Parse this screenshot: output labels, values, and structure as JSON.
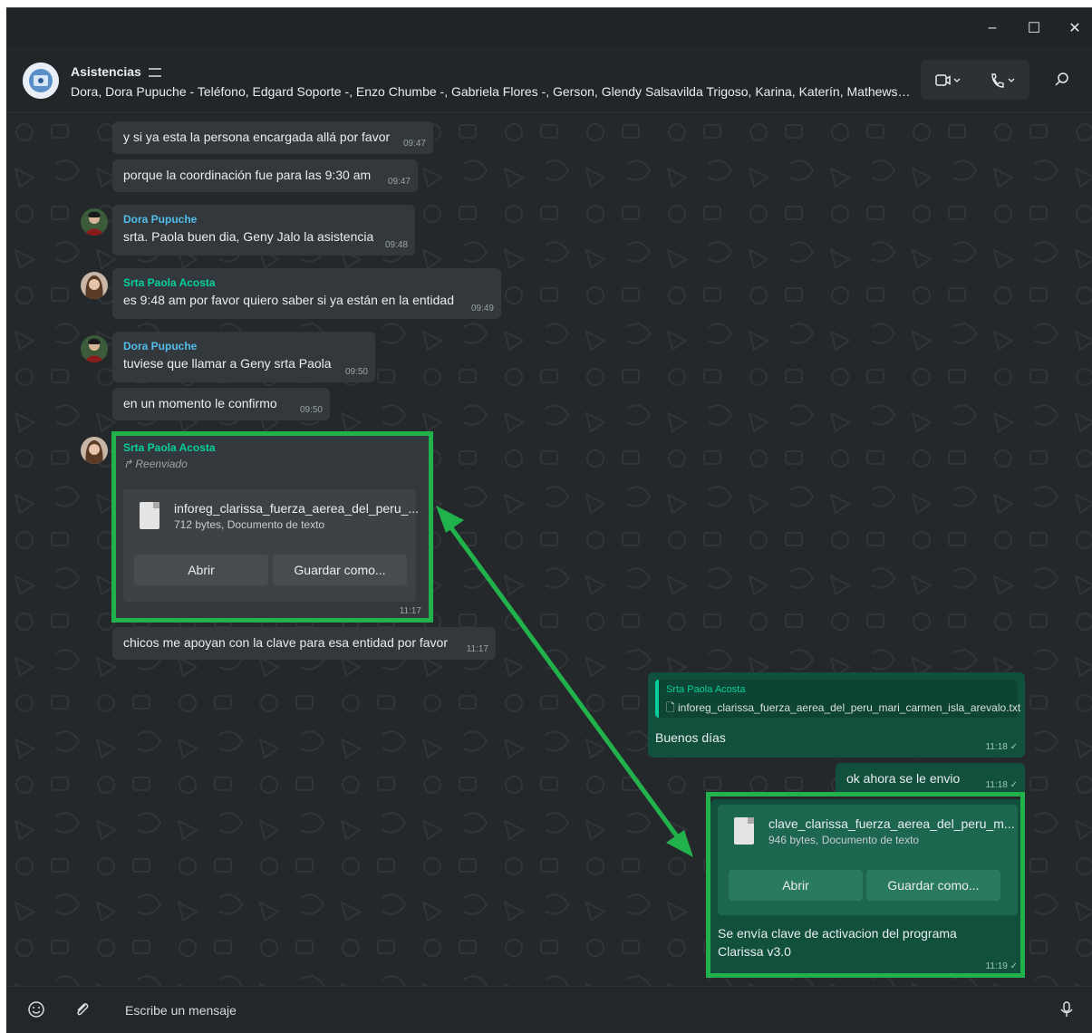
{
  "window": {
    "minimize": "–",
    "maximize": "☐",
    "close": "✕"
  },
  "header": {
    "title": "Asistencias",
    "participants": "Dora, Dora Pupuche - Teléfono, Edgard Soporte -, Enzo Chumbe -, Gabriela Flores -, Gerson, Glendy Salsavilda Trigoso, Karina, Katerín, Mathews Gue..."
  },
  "messages": {
    "m1": {
      "text": "y si ya esta la persona encargada allá por favor",
      "time": "09:47"
    },
    "m2": {
      "text": "porque la coordinación fue para las 9:30 am",
      "time": "09:47"
    },
    "m3": {
      "sender": "Dora Pupuche",
      "text": "srta. Paola buen dia, Geny Jalo la asistencia",
      "time": "09:48"
    },
    "m4": {
      "sender": "Srta Paola Acosta",
      "text": "es 9:48 am por favor quiero saber si ya están en la entidad",
      "time": "09:49"
    },
    "m5": {
      "sender": "Dora Pupuche",
      "text": "tuviese que llamar a Geny srta Paola",
      "time": "09:50"
    },
    "m6": {
      "text": "en un momento le confirmo",
      "time": "09:50"
    },
    "m7": {
      "sender": "Srta Paola Acosta",
      "forwarded": "Reenviado",
      "file_name": "inforeg_clarissa_fuerza_aerea_del_peru_...",
      "file_meta": "712 bytes, Documento de texto",
      "open": "Abrir",
      "save": "Guardar como...",
      "time": "11:17"
    },
    "m8": {
      "text": "chicos me apoyan con la clave para esa entidad por favor",
      "time": "11:17"
    },
    "m9": {
      "quote_sender": "Srta Paola Acosta",
      "quote_file": "inforeg_clarissa_fuerza_aerea_del_peru_mari_carmen_isla_arevalo.txt",
      "text": "Buenos días",
      "time": "11:18 ✓"
    },
    "m10": {
      "text": "ok ahora se le envio",
      "time": "11:18 ✓"
    },
    "m11": {
      "file_name": "clave_clarissa_fuerza_aerea_del_peru_m...",
      "file_meta": "946 bytes, Documento de texto",
      "open": "Abrir",
      "save": "Guardar como...",
      "caption_line1": "Se envía clave de activacion del programa",
      "caption_line2": "Clarissa v3.0",
      "time": "11:19 ✓"
    }
  },
  "composer": {
    "placeholder": "Escribe un mensaje"
  },
  "colors": {
    "highlight": "#22b24c",
    "sender_blue": "#53bdeb",
    "sender_green": "#06cf9c",
    "outgoing": "#11503c"
  }
}
